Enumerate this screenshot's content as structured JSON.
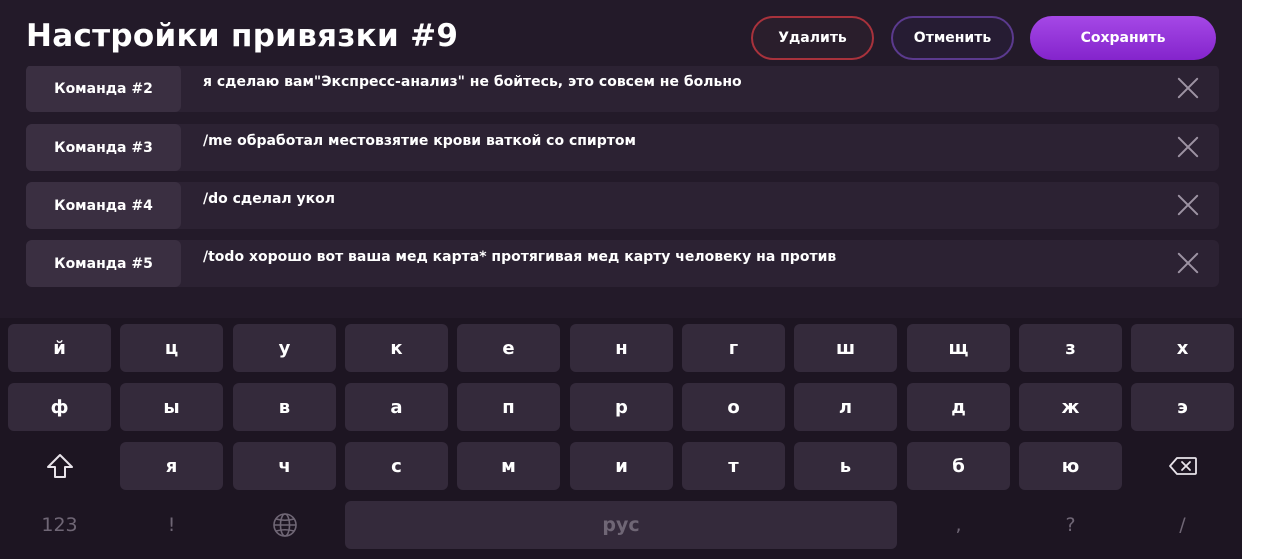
{
  "header": {
    "title": "Настройки привязки #9",
    "delete_label": "Удалить",
    "cancel_label": "Отменить",
    "save_label": "Сохранить"
  },
  "commands": [
    {
      "label": "Команда #2",
      "text": "я сделаю вам\"Экспресс-анализ\" не бойтесь, это совсем не больно"
    },
    {
      "label": "Команда #3",
      "text": "/me обработал местовзятие крови ваткой со спиртом"
    },
    {
      "label": "Команда #4",
      "text": "/do сделал укол"
    },
    {
      "label": "Команда #5",
      "text": "/todo хорошо вот ваша мед карта* протягивая мед карту человеку на против"
    }
  ],
  "keyboard": {
    "row1": [
      "й",
      "ц",
      "у",
      "к",
      "е",
      "н",
      "г",
      "ш",
      "щ",
      "з",
      "х"
    ],
    "row2": [
      "ф",
      "ы",
      "в",
      "а",
      "п",
      "р",
      "о",
      "л",
      "д",
      "ж",
      "э"
    ],
    "row3": [
      "я",
      "ч",
      "с",
      "м",
      "и",
      "т",
      "ь",
      "б",
      "ю"
    ],
    "bottom": {
      "numbers": "123",
      "exclamation": "!",
      "space": "рус",
      "comma": ",",
      "question": "?",
      "slash": "/"
    },
    "icons": {
      "shift": "shift-arrow-icon",
      "globe": "globe-icon",
      "backspace": "backspace-icon"
    }
  },
  "colors": {
    "background": "#231a29",
    "accent": "#9436d9",
    "delete_border": "#a8323c",
    "cancel_border": "#5b3a8e"
  }
}
